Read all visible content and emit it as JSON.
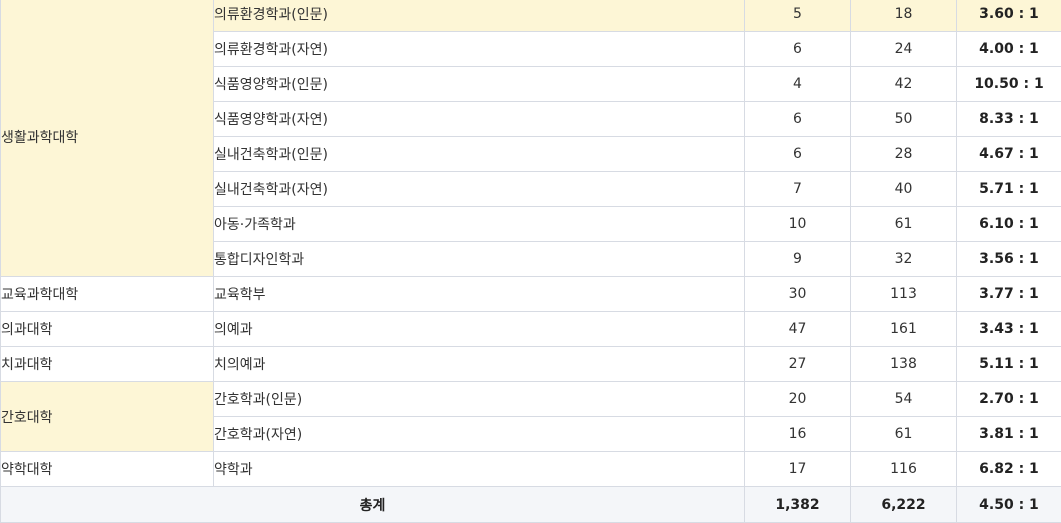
{
  "table": {
    "rows": [
      {
        "college": "생활과학대학",
        "span": 8,
        "dept": "의류환경학과(인문)",
        "quota": "5",
        "applicants": "18",
        "ratio": "3.60 : 1",
        "highlight": true
      },
      {
        "dept": "의류환경학과(자연)",
        "quota": "6",
        "applicants": "24",
        "ratio": "4.00 : 1"
      },
      {
        "dept": "식품영양학과(인문)",
        "quota": "4",
        "applicants": "42",
        "ratio": "10.50 : 1"
      },
      {
        "dept": "식품영양학과(자연)",
        "quota": "6",
        "applicants": "50",
        "ratio": "8.33 : 1"
      },
      {
        "dept": "실내건축학과(인문)",
        "quota": "6",
        "applicants": "28",
        "ratio": "4.67 : 1"
      },
      {
        "dept": "실내건축학과(자연)",
        "quota": "7",
        "applicants": "40",
        "ratio": "5.71 : 1"
      },
      {
        "dept": "아동·가족학과",
        "quota": "10",
        "applicants": "61",
        "ratio": "6.10 : 1"
      },
      {
        "dept": "통합디자인학과",
        "quota": "9",
        "applicants": "32",
        "ratio": "3.56 : 1"
      },
      {
        "college": "교육과학대학",
        "span": 1,
        "dept": "교육학부",
        "quota": "30",
        "applicants": "113",
        "ratio": "3.77 : 1"
      },
      {
        "college": "의과대학",
        "span": 1,
        "dept": "의예과",
        "quota": "47",
        "applicants": "161",
        "ratio": "3.43 : 1"
      },
      {
        "college": "치과대학",
        "span": 1,
        "dept": "치의예과",
        "quota": "27",
        "applicants": "138",
        "ratio": "5.11 : 1"
      },
      {
        "college": "간호대학",
        "span": 2,
        "dept": "간호학과(인문)",
        "quota": "20",
        "applicants": "54",
        "ratio": "2.70 : 1"
      },
      {
        "dept": "간호학과(자연)",
        "quota": "16",
        "applicants": "61",
        "ratio": "3.81 : 1"
      },
      {
        "college": "약학대학",
        "span": 1,
        "dept": "약학과",
        "quota": "17",
        "applicants": "116",
        "ratio": "6.82 : 1"
      }
    ],
    "total": {
      "label": "총계",
      "quota": "1,382",
      "applicants": "6,222",
      "ratio": "4.50 : 1"
    }
  },
  "colors": {
    "highlight": "#fdf6d6",
    "border": "#d7dbe3",
    "total_bg": "#f4f6f9"
  }
}
